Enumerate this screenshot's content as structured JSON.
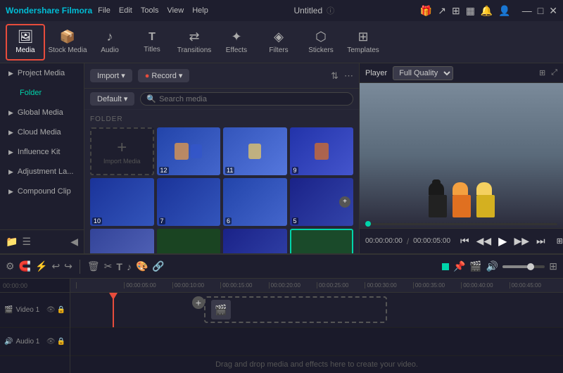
{
  "app": {
    "name": "Wondershare Filmora",
    "title": "Untitled",
    "logo": "🎬"
  },
  "menus": [
    "File",
    "Edit",
    "Tools",
    "View",
    "Help"
  ],
  "toolbar": {
    "items": [
      {
        "id": "media",
        "label": "Media",
        "icon": "🖼",
        "active": true
      },
      {
        "id": "stock",
        "label": "Stock Media",
        "icon": "📦",
        "active": false
      },
      {
        "id": "audio",
        "label": "Audio",
        "icon": "🎵",
        "active": false
      },
      {
        "id": "titles",
        "label": "Titles",
        "icon": "T",
        "active": false
      },
      {
        "id": "transitions",
        "label": "Transitions",
        "icon": "⚡",
        "active": false
      },
      {
        "id": "effects",
        "label": "Effects",
        "icon": "✨",
        "active": false
      },
      {
        "id": "filters",
        "label": "Filters",
        "icon": "🔮",
        "active": false
      },
      {
        "id": "stickers",
        "label": "Stickers",
        "icon": "🏷",
        "active": false
      },
      {
        "id": "templates",
        "label": "Templates",
        "icon": "📋",
        "active": false
      }
    ]
  },
  "leftpanel": {
    "items": [
      {
        "label": "Project Media",
        "active": false
      },
      {
        "label": "Folder",
        "active": true
      },
      {
        "label": "Global Media",
        "active": false
      },
      {
        "label": "Cloud Media",
        "active": false
      },
      {
        "label": "Influence Kit",
        "active": false
      },
      {
        "label": "Adjustment La...",
        "active": false
      },
      {
        "label": "Compound Clip",
        "active": false
      }
    ]
  },
  "media": {
    "import_label": "Import",
    "record_label": "Record",
    "default_label": "Default",
    "search_placeholder": "Search media",
    "folder_label": "FOLDER",
    "import_media_label": "Import Media",
    "thumbnails": [
      {
        "num": "",
        "type": "add"
      },
      {
        "num": "12",
        "type": "lego"
      },
      {
        "num": "11",
        "type": "lego"
      },
      {
        "num": "9",
        "type": "lego"
      },
      {
        "num": "10",
        "type": "lego"
      },
      {
        "num": "7",
        "type": "lego"
      },
      {
        "num": "6",
        "type": "lego"
      },
      {
        "num": "5",
        "type": "lego",
        "has_dot": true
      },
      {
        "num": "",
        "type": "lego",
        "row3": true
      },
      {
        "num": "",
        "type": "lego",
        "row3": true
      },
      {
        "num": "",
        "type": "lego",
        "row3": true
      },
      {
        "num": "",
        "type": "green",
        "row3": true,
        "selected": true
      }
    ]
  },
  "player": {
    "label": "Player",
    "quality": "Full Quality",
    "time_current": "00:00:00:00",
    "time_total": "00:00:05:00",
    "controls": [
      "⏮",
      "◀◀",
      "▶",
      "▶▶",
      "⏭"
    ]
  },
  "timeline": {
    "toolbar_icons": [
      "✂",
      "🔗",
      "↩",
      "↪",
      "🗑",
      "✂",
      "T",
      "🎵",
      "⚙",
      "🔗",
      "⭕",
      "📍",
      "🎬",
      "🔊",
      "🔈",
      "🔇"
    ],
    "ruler_marks": [
      "00:00:05:00",
      "00:00:10:00",
      "00:00:15:00",
      "00:00:20:00",
      "00:00:25:00",
      "00:00:30:00",
      "00:00:35:00",
      "00:00:40:00",
      "00:00:45:00"
    ],
    "tracks": [
      {
        "label": "Video 1",
        "type": "video"
      },
      {
        "label": "Audio 1",
        "type": "audio"
      }
    ],
    "drop_hint": "Drag and drop media and effects here to create your video."
  }
}
